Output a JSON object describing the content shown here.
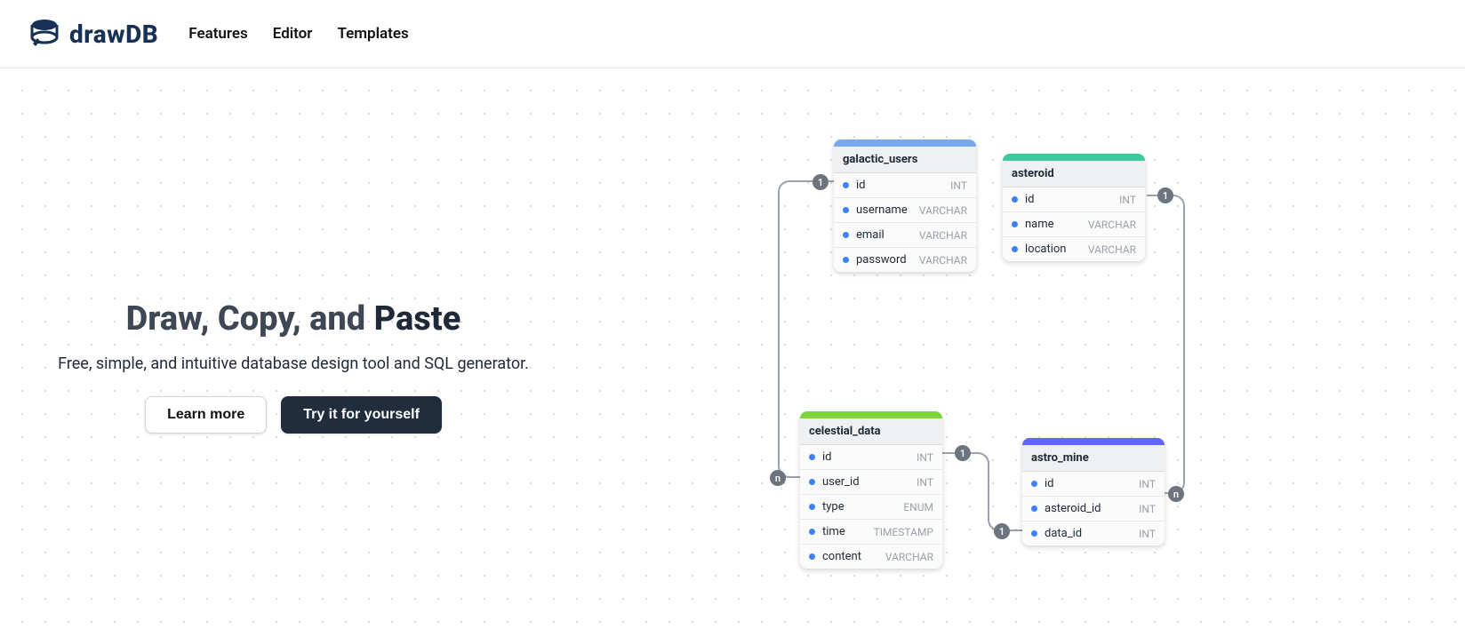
{
  "brand": "drawDB",
  "nav": {
    "features": "Features",
    "editor": "Editor",
    "templates": "Templates"
  },
  "hero": {
    "title_a": "Draw, Copy, and ",
    "title_b": "Paste",
    "subtitle": "Free, simple, and intuitive database design tool and SQL generator.",
    "learn": "Learn more",
    "try": "Try it for yourself"
  },
  "colors": {
    "blue": "#7aa7f0",
    "teal": "#3fc89b",
    "green": "#7fd43b",
    "indigo": "#6366f1"
  },
  "tables": {
    "galactic_users": {
      "name": "galactic_users",
      "fields": [
        {
          "name": "id",
          "type": "INT"
        },
        {
          "name": "username",
          "type": "VARCHAR"
        },
        {
          "name": "email",
          "type": "VARCHAR"
        },
        {
          "name": "password",
          "type": "VARCHAR"
        }
      ]
    },
    "asteroid": {
      "name": "asteroid",
      "fields": [
        {
          "name": "id",
          "type": "INT"
        },
        {
          "name": "name",
          "type": "VARCHAR"
        },
        {
          "name": "location",
          "type": "VARCHAR"
        }
      ]
    },
    "celestial_data": {
      "name": "celestial_data",
      "fields": [
        {
          "name": "id",
          "type": "INT"
        },
        {
          "name": "user_id",
          "type": "INT"
        },
        {
          "name": "type",
          "type": "ENUM"
        },
        {
          "name": "time",
          "type": "TIMESTAMP"
        },
        {
          "name": "content",
          "type": "VARCHAR"
        }
      ]
    },
    "astro_mine": {
      "name": "astro_mine",
      "fields": [
        {
          "name": "id",
          "type": "INT"
        },
        {
          "name": "asteroid_id",
          "type": "INT"
        },
        {
          "name": "data_id",
          "type": "INT"
        }
      ]
    }
  },
  "badges": {
    "one": "1",
    "many": "n"
  }
}
